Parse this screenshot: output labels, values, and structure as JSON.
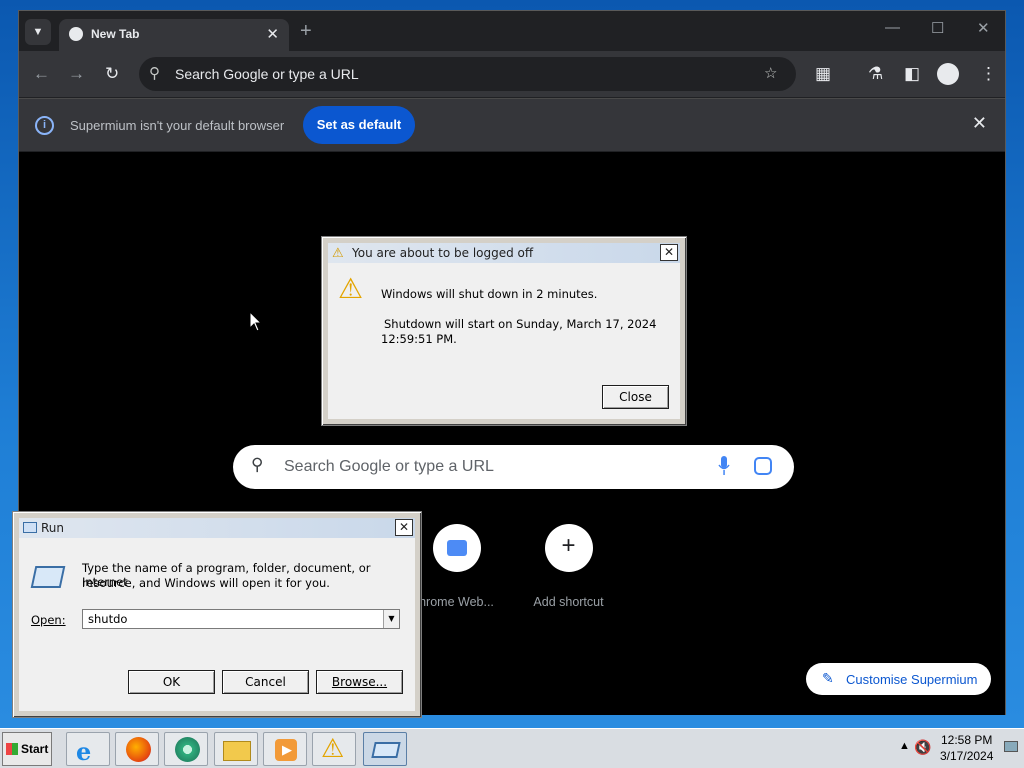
{
  "browser": {
    "tab_title": "New Tab",
    "new_tab": "+",
    "omnibox_placeholder": "Search Google or type a URL",
    "infobar_message": "Supermium isn't your default browser",
    "set_default_label": "Set as default",
    "ntp_search_placeholder": "Search Google or type a URL",
    "shortcuts": [
      {
        "label": "hrome Web..."
      },
      {
        "label": "Add shortcut",
        "symbol": "+"
      }
    ],
    "customise_label": "Customise Supermium"
  },
  "logoff_dialog": {
    "title": "You are about to be logged off",
    "line1": "Windows will shut down in 2 minutes.",
    "line2": "Shutdown will start on Sunday, March 17, 2024",
    "line3": "12:59:51 PM.",
    "close_label": "Close"
  },
  "run_dialog": {
    "title": "Run",
    "description_line1": "Type the name of a program, folder, document, or Internet",
    "description_line2": "resource, and Windows will open it for you.",
    "open_label": "Open:",
    "open_value": "shutdo",
    "ok_label": "OK",
    "cancel_label": "Cancel",
    "browse_label": "Browse..."
  },
  "taskbar": {
    "start_label": "Start",
    "apps": [
      "internet-explorer-icon",
      "firefox-icon",
      "supermium-icon",
      "file-explorer-icon",
      "media-player-icon",
      "warning-icon",
      "run-icon"
    ],
    "time": "12:58 PM",
    "date": "3/17/2024"
  },
  "colors": {
    "accent": "#0b57d0",
    "ntp_background": "#000000",
    "toolbar": "#35363a"
  }
}
